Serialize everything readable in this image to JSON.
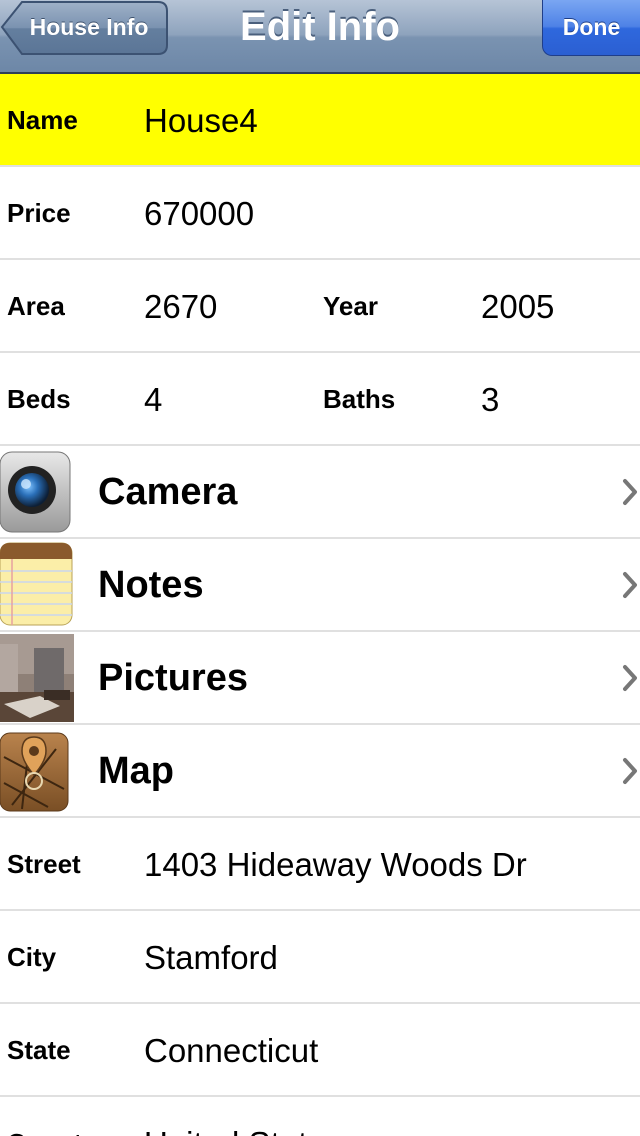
{
  "nav": {
    "title": "Edit Info",
    "back_label": "House Info",
    "done_label": "Done"
  },
  "fields": {
    "name": {
      "label": "Name",
      "value": "House4"
    },
    "price": {
      "label": "Price",
      "value": "670000"
    },
    "area": {
      "label": "Area",
      "value": "2670"
    },
    "year": {
      "label": "Year",
      "value": "2005"
    },
    "beds": {
      "label": "Beds",
      "value": "4"
    },
    "baths": {
      "label": "Baths",
      "value": "3"
    }
  },
  "links": {
    "camera": {
      "label": "Camera",
      "icon": "camera-icon"
    },
    "notes": {
      "label": "Notes",
      "icon": "notepad-icon"
    },
    "pictures": {
      "label": "Pictures",
      "icon": "photo-thumbnail"
    },
    "map": {
      "label": "Map",
      "icon": "map-pin-icon"
    }
  },
  "address": {
    "street": {
      "label": "Street",
      "value": "1403 Hideaway Woods Dr"
    },
    "city": {
      "label": "City",
      "value": "Stamford"
    },
    "state": {
      "label": "State",
      "value": "Connecticut"
    },
    "country": {
      "label": "Country",
      "value": "United States"
    }
  },
  "colors": {
    "highlight_row": "#ffff00",
    "navbar": "#7a93b1",
    "done_button": "#2f68dd"
  }
}
